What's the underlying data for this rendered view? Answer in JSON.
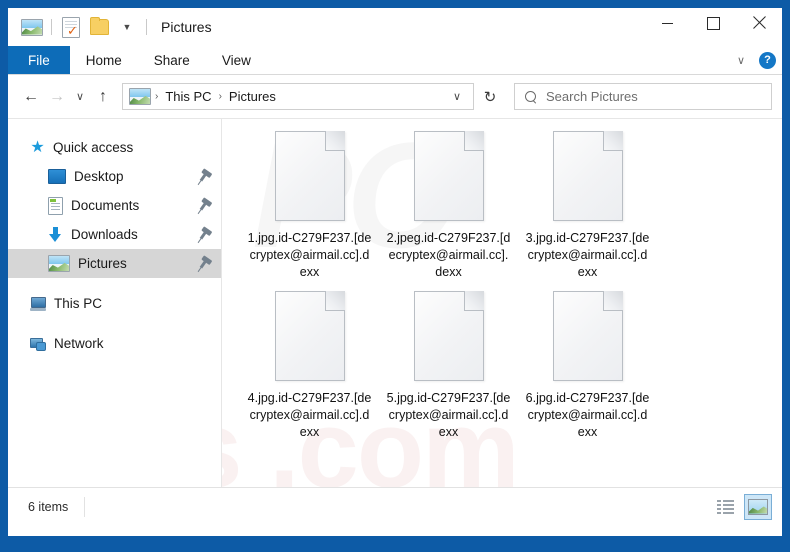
{
  "window": {
    "title": "Pictures",
    "quick_access_icons": [
      "picture-icon",
      "properties-icon",
      "new-folder-icon",
      "customize-chevron-icon"
    ],
    "controls": {
      "minimize": "–",
      "maximize": "□",
      "close": "✕"
    }
  },
  "ribbon": {
    "tabs": [
      "File",
      "Home",
      "Share",
      "View"
    ],
    "collapse_chevron": "∨",
    "help_label": "?"
  },
  "nav": {
    "back": "←",
    "forward": "→",
    "recent_chevron": "∨",
    "up": "↑",
    "refresh": "↻",
    "breadcrumb": [
      "This PC",
      "Pictures"
    ],
    "breadcrumb_sep": "›",
    "address_chevron": "∨"
  },
  "search": {
    "placeholder": "Search Pictures"
  },
  "sidebar": {
    "items": [
      {
        "label": "Quick access",
        "icon": "star-icon",
        "child": false,
        "pinned": false,
        "selected": false
      },
      {
        "label": "Desktop",
        "icon": "desktop-icon",
        "child": true,
        "pinned": true,
        "selected": false
      },
      {
        "label": "Documents",
        "icon": "documents-icon",
        "child": true,
        "pinned": true,
        "selected": false
      },
      {
        "label": "Downloads",
        "icon": "downloads-icon",
        "child": true,
        "pinned": true,
        "selected": false
      },
      {
        "label": "Pictures",
        "icon": "pictures-icon",
        "child": true,
        "pinned": true,
        "selected": true
      },
      {
        "label": "This PC",
        "icon": "this-pc-icon",
        "child": false,
        "pinned": false,
        "selected": false
      },
      {
        "label": "Network",
        "icon": "network-icon",
        "child": false,
        "pinned": false,
        "selected": false
      }
    ]
  },
  "files": [
    {
      "name": "1.jpg.id-C279F237.[decryptex@airmail.cc].dexx",
      "icon": "blank-file-icon"
    },
    {
      "name": "2.jpeg.id-C279F237.[decryptex@airmail.cc].dexx",
      "icon": "blank-file-icon"
    },
    {
      "name": "3.jpg.id-C279F237.[decryptex@airmail.cc].dexx",
      "icon": "blank-file-icon"
    },
    {
      "name": "4.jpg.id-C279F237.[decryptex@airmail.cc].dexx",
      "icon": "blank-file-icon"
    },
    {
      "name": "5.jpg.id-C279F237.[decryptex@airmail.cc].dexx",
      "icon": "blank-file-icon"
    },
    {
      "name": "6.jpg.id-C279F237.[decryptex@airmail.cc].dexx",
      "icon": "blank-file-icon"
    }
  ],
  "watermark": {
    "top": "PC",
    "bottom": "ris   .com"
  },
  "status": {
    "items_count": "6 items",
    "views": [
      {
        "name": "details-view-button",
        "selected": false
      },
      {
        "name": "large-icons-view-button",
        "selected": true
      }
    ]
  },
  "colors": {
    "frame_blue": "#0d5ba6",
    "file_tab_blue": "#0d6cb8",
    "selection_gray": "#d6d6d6",
    "view_selected_blue": "#cde6f7"
  }
}
